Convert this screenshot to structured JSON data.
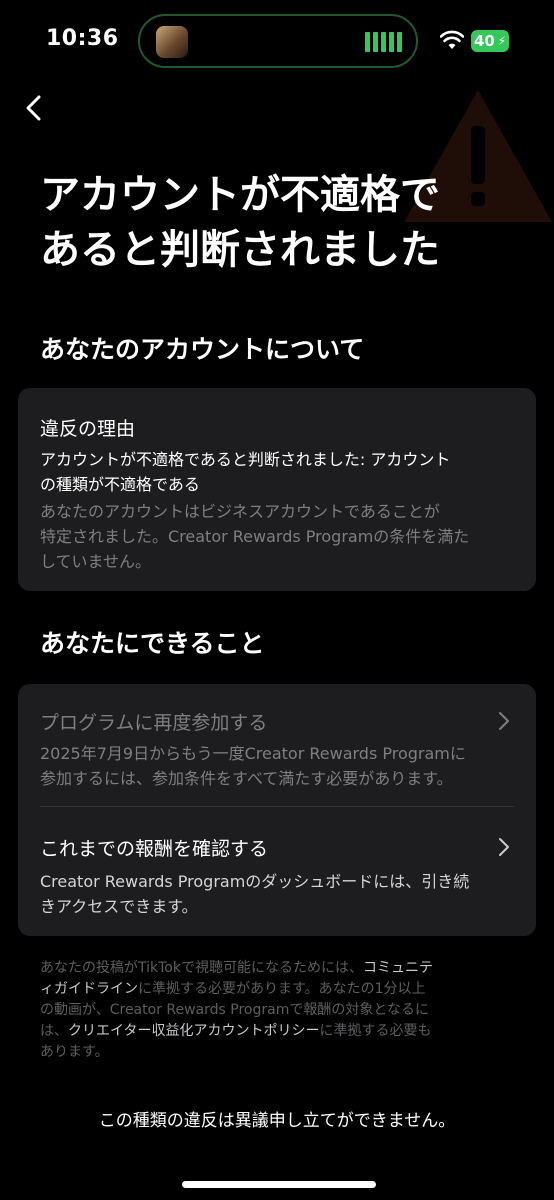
{
  "status_bar": {
    "time": "10:36",
    "battery_level": "40"
  },
  "page": {
    "title_line1": "アカウントが不適格で",
    "title_line2": "あると判断されました"
  },
  "about": {
    "heading": "あなたのアカウントについて",
    "card": {
      "title": "違反の理由",
      "detail_lines": [
        "アカウントが不適格であると判断されました: アカウント",
        "の種類が不適格である"
      ],
      "explanation_lines": [
        "あなたのアカウントはビジネスアカウントであることが",
        "特定されました。Creator Rewards Programの条件を満た",
        "していません。"
      ]
    }
  },
  "actions": {
    "heading": "あなたにできること",
    "rejoin": {
      "title": "プログラムに再度参加する",
      "description_lines": [
        "2025年7月9日からもう一度Creator Rewards Programに",
        "参加するには、参加条件をすべて満たす必要があります。"
      ]
    },
    "rewards": {
      "title": "これまでの報酬を確認する",
      "description_lines": [
        "Creator Rewards Programのダッシュボードには、引き続",
        "きアクセスできます。"
      ]
    }
  },
  "footer_note": {
    "line1_prefix": "あなたの投稿がTikTokで視聴可能になるためには、",
    "line1_link": "コミュニテ",
    "line2_link": "ィガイドライン",
    "line2_suffix": "に準拠する必要があります。あなたの1分以上",
    "line3": "の動画が、Creator Rewards Programで報酬の対象となるに",
    "line4_prefix": "は、",
    "line4_link": "クリエイター収益化アカウントポリシー",
    "line4_suffix": "に準拠する必要も",
    "line5": "あります。"
  },
  "bottom_notice": "この種類の違反は異議申し立てができません。",
  "colors": {
    "background": "#000000",
    "card": "#1d1d1f",
    "secondary_text": "#7f7f82",
    "footer_text": "#5e5e61",
    "battery_green": "#34c759",
    "warning_accent": "#3a1a10"
  },
  "icons": {
    "back": "chevron-left-icon",
    "row_arrow": "chevron-right-icon",
    "wifi": "wifi-icon",
    "warning": "warning-triangle-icon"
  }
}
